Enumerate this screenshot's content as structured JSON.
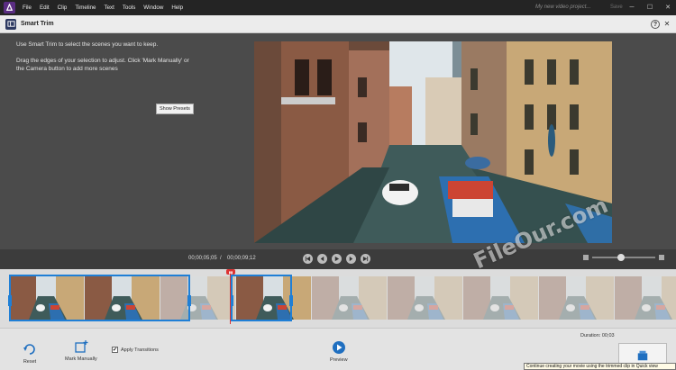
{
  "menubar": {
    "items": [
      "File",
      "Edit",
      "Clip",
      "Timeline",
      "Text",
      "Tools",
      "Window",
      "Help"
    ],
    "project_name": "My new video project...",
    "save_label": "Save"
  },
  "dialog": {
    "title": "Smart Trim",
    "instruction_1": "Use Smart Trim to select the scenes you want to keep.",
    "instruction_2": "Drag the edges of your selection to adjust. Click 'Mark Manually' or the Camera button to add more scenes",
    "show_presets_label": "Show Presets",
    "help_label": "?",
    "close_label": "✕"
  },
  "controls": {
    "current_time": "00;00;05;05",
    "separator": "/",
    "total_time": "00;00;09;12",
    "zoom_level": 0.45
  },
  "playhead_label": "▮▮",
  "toolbar": {
    "reset_label": "Reset",
    "mark_manually_label": "Mark Manually",
    "apply_transitions_label": "Apply Transitions",
    "apply_transitions_checked": true,
    "preview_label": "Preview",
    "duration_label": "Duration: 00;03",
    "tooltip": "Continue creating your movie using the trimmed clip in Quick view"
  },
  "watermark": "FileOur.com",
  "colors": {
    "selection": "#1f7fd6",
    "playhead": "#d33333",
    "accent_logo": "#5a2d82"
  }
}
